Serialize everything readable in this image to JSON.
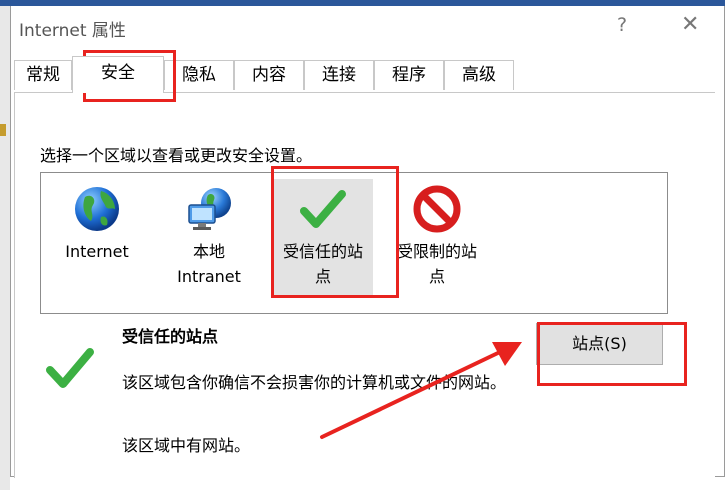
{
  "window": {
    "title": "Internet 属性",
    "help_glyph": "?",
    "close_glyph": "✕"
  },
  "tabs": [
    {
      "label": "常规"
    },
    {
      "label": "安全",
      "active": true
    },
    {
      "label": "隐私"
    },
    {
      "label": "内容"
    },
    {
      "label": "连接"
    },
    {
      "label": "程序"
    },
    {
      "label": "高级"
    }
  ],
  "security": {
    "instruction": "选择一个区域以查看或更改安全设置。",
    "zones": [
      {
        "line1": "Internet",
        "line2": "",
        "icon": "globe-icon"
      },
      {
        "line1": "本地",
        "line2": "Intranet",
        "icon": "local-intranet-icon"
      },
      {
        "line1": "受信任的站",
        "line2": "点",
        "icon": "checkmark-icon",
        "selected": true
      },
      {
        "line1": "受限制的站",
        "line2": "点",
        "icon": "prohibited-icon"
      }
    ],
    "selected_zone": {
      "title": "受信任的站点",
      "description": "该区域包含你确信不会损害你的计算机或文件的网站。",
      "sites_status": "该区域中有网站。",
      "icon": "checkmark-icon"
    },
    "sites_button": "站点(S)"
  },
  "colors": {
    "highlight_red": "#e8231f",
    "check_green": "#3cb043",
    "prohibit_red": "#d71e1e",
    "selected_bg": "#e3e3e3"
  }
}
